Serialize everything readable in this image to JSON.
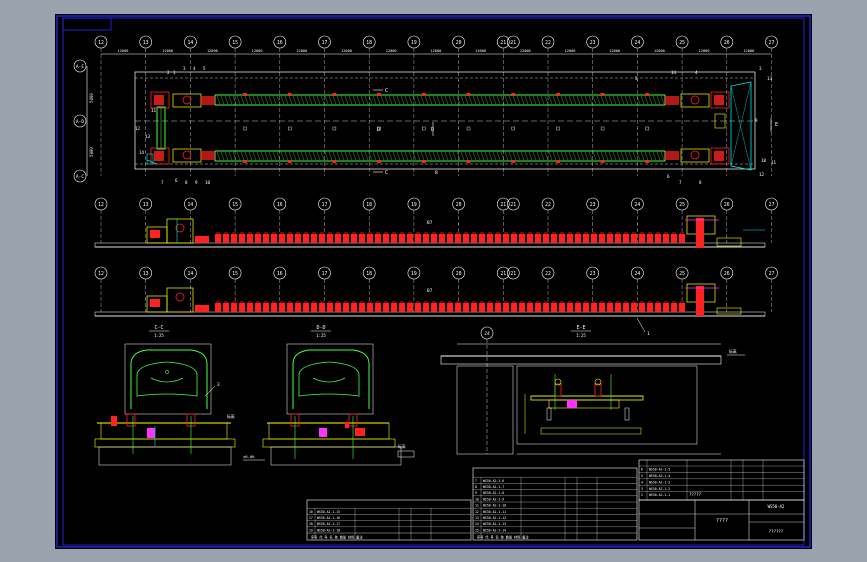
{
  "window": {
    "background": "#9aa3ad",
    "sheet_background": "#000000"
  },
  "colors": {
    "frame": "#2b2bff",
    "line": "#ffffff",
    "conveyor": "#44ff44",
    "equipment": "#ff2222",
    "accent": "#ffff00",
    "section": "#00e5e5",
    "magenta": "#ff33ff"
  },
  "plan": {
    "grid_labels": [
      "12",
      "13",
      "14",
      "15",
      "16",
      "17",
      "18",
      "19",
      "20",
      "21",
      "22",
      "23",
      "24",
      "25",
      "26",
      "27"
    ],
    "extra_grid_label": "21",
    "row_labels": [
      "A-E",
      "A-D",
      "A-C"
    ],
    "span_label": "12000",
    "dim_labels": [
      "5000",
      "5000"
    ],
    "section_marks": {
      "c_upper": "C",
      "c_lower": "C",
      "d_left": "D",
      "d_right": "D",
      "e": "E",
      "b": "B"
    },
    "callouts_left": [
      "1",
      "2",
      "3",
      "4",
      "5",
      "6",
      "7",
      "8",
      "9",
      "10",
      "11",
      "12",
      "13",
      "14"
    ],
    "callouts_right": [
      "3",
      "4",
      "5",
      "6",
      "7",
      "8",
      "9",
      "10",
      "11",
      "12",
      "13",
      "14"
    ]
  },
  "elevations": {
    "grid_labels": [
      "12",
      "13",
      "14",
      "15",
      "16",
      "17",
      "18",
      "19",
      "20",
      "21",
      "22",
      "23",
      "24",
      "25",
      "26",
      "27"
    ],
    "marker_upper": "B7",
    "marker_lower": "B7",
    "callout": "1"
  },
  "sections": {
    "cc": {
      "title": "C-C",
      "scale": "1:25",
      "mark": "3",
      "level": "标高"
    },
    "dd": {
      "title": "D-D",
      "scale": "1:25",
      "level": "±0.00",
      "side_label": "标高"
    },
    "ee": {
      "title": "E-E",
      "scale": "1:25",
      "grid": "24",
      "level": "标高"
    }
  },
  "title_blocks": {
    "left": {
      "rows": [
        {
          "no": "19",
          "code": "WS50-A2-1-18"
        },
        {
          "no": "18",
          "code": "WS50-A2-1-17"
        },
        {
          "no": "17",
          "code": "WS50-A2-1-16"
        },
        {
          "no": "16",
          "code": "WS50-A2-1-15"
        }
      ],
      "footer": "序号  代  号  名  称  数量  材料  备注"
    },
    "middle": {
      "rows": [
        {
          "no": "15",
          "code": "WS50-A2-1-14"
        },
        {
          "no": "14",
          "code": "WS50-A2-1-13"
        },
        {
          "no": "13",
          "code": "WS50-A2-1-12"
        },
        {
          "no": "12",
          "code": "WS50-A2-1-11"
        },
        {
          "no": "11",
          "code": "WS50-A2-1-10"
        },
        {
          "no": "10",
          "code": "WS50-A2-1-9"
        },
        {
          "no": "9",
          "code": "WS50-A2-1-8"
        },
        {
          "no": "8",
          "code": "WS50-A2-1-7"
        },
        {
          "no": "7",
          "code": "WS50-A2-1-6"
        }
      ],
      "footer": "序号  代  号  名  称  数量  材料  备注"
    },
    "right": {
      "rows": [
        {
          "no": "6",
          "code": "WS50-A2-1-5"
        },
        {
          "no": "5",
          "code": "WS50-A2-1-4"
        },
        {
          "no": "4",
          "code": "WS50-A2-1-3"
        },
        {
          "no": "3",
          "code": "WS50-A2-1-2"
        },
        {
          "no": "2",
          "code": "WS50-A2-1-1"
        }
      ],
      "mid_label": "?????",
      "drawing_title": "????",
      "sheet_code": "WS50-A2",
      "company": "??????"
    }
  }
}
